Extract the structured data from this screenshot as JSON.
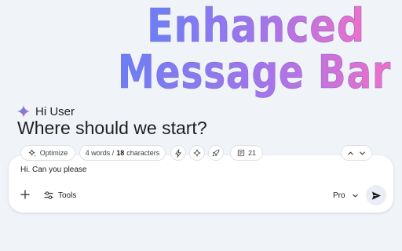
{
  "banner": {
    "line1": "Enhanced",
    "line2": "Message Bar"
  },
  "greeting": {
    "icon": "gemini-sparkle-icon",
    "text": "Hi User",
    "headline": "Where should we start?"
  },
  "toolbar": {
    "optimize_label": "Optimize",
    "word_count": "4 words /",
    "char_count": "18",
    "char_suffix": "characters",
    "icons": [
      "bolt-icon",
      "sparkle-icon",
      "rocket-icon"
    ],
    "token_count": "21",
    "nav_icons": [
      "chevron-up-icon",
      "chevron-down-icon"
    ]
  },
  "input": {
    "value": "Hi. Can you please"
  },
  "controls": {
    "add_icon": "plus-icon",
    "tools_label": "Tools",
    "model_label": "Pro",
    "send_icon": "send-icon"
  },
  "colors": {
    "background": "#f0f4f9",
    "banner_gradient_start": "#6d7cf6",
    "banner_gradient_end": "#f16fc8",
    "card": "#ffffff"
  }
}
